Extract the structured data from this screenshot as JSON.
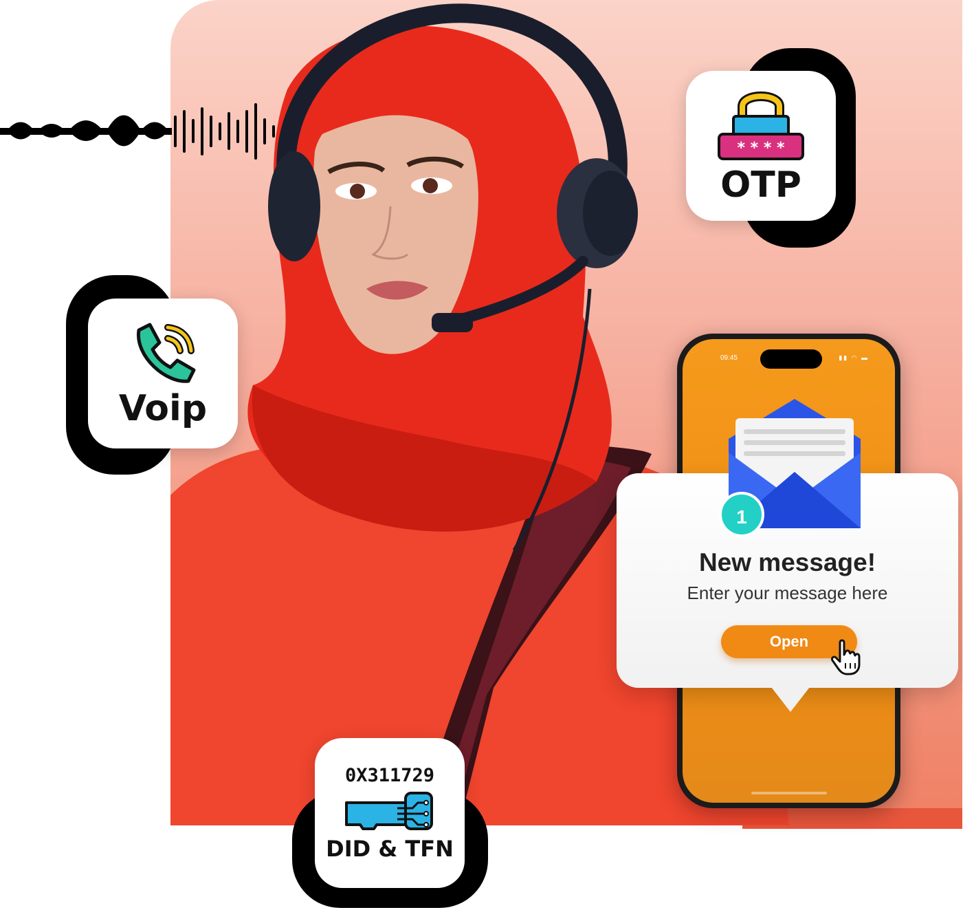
{
  "voip_badge": {
    "label": "Voip",
    "icon": "phone-ringing-icon"
  },
  "otp_badge": {
    "label": "OTP",
    "masked_code": "* * * *",
    "icon": "padlock-icon"
  },
  "did_badge": {
    "code": "0X311729",
    "label": "DID & TFN",
    "icon": "sim-chip-icon"
  },
  "phone": {
    "time": "09:45",
    "status_icons": "▮▮ ◠ ▬"
  },
  "notification": {
    "count": "1",
    "title": "New message!",
    "body": "Enter your message here",
    "button_label": "Open"
  },
  "colors": {
    "accent_orange": "#f08a14",
    "accent_teal": "#22d0c6",
    "envelope_blue": "#2a55e6",
    "background_pink": "#fbd3c8"
  }
}
